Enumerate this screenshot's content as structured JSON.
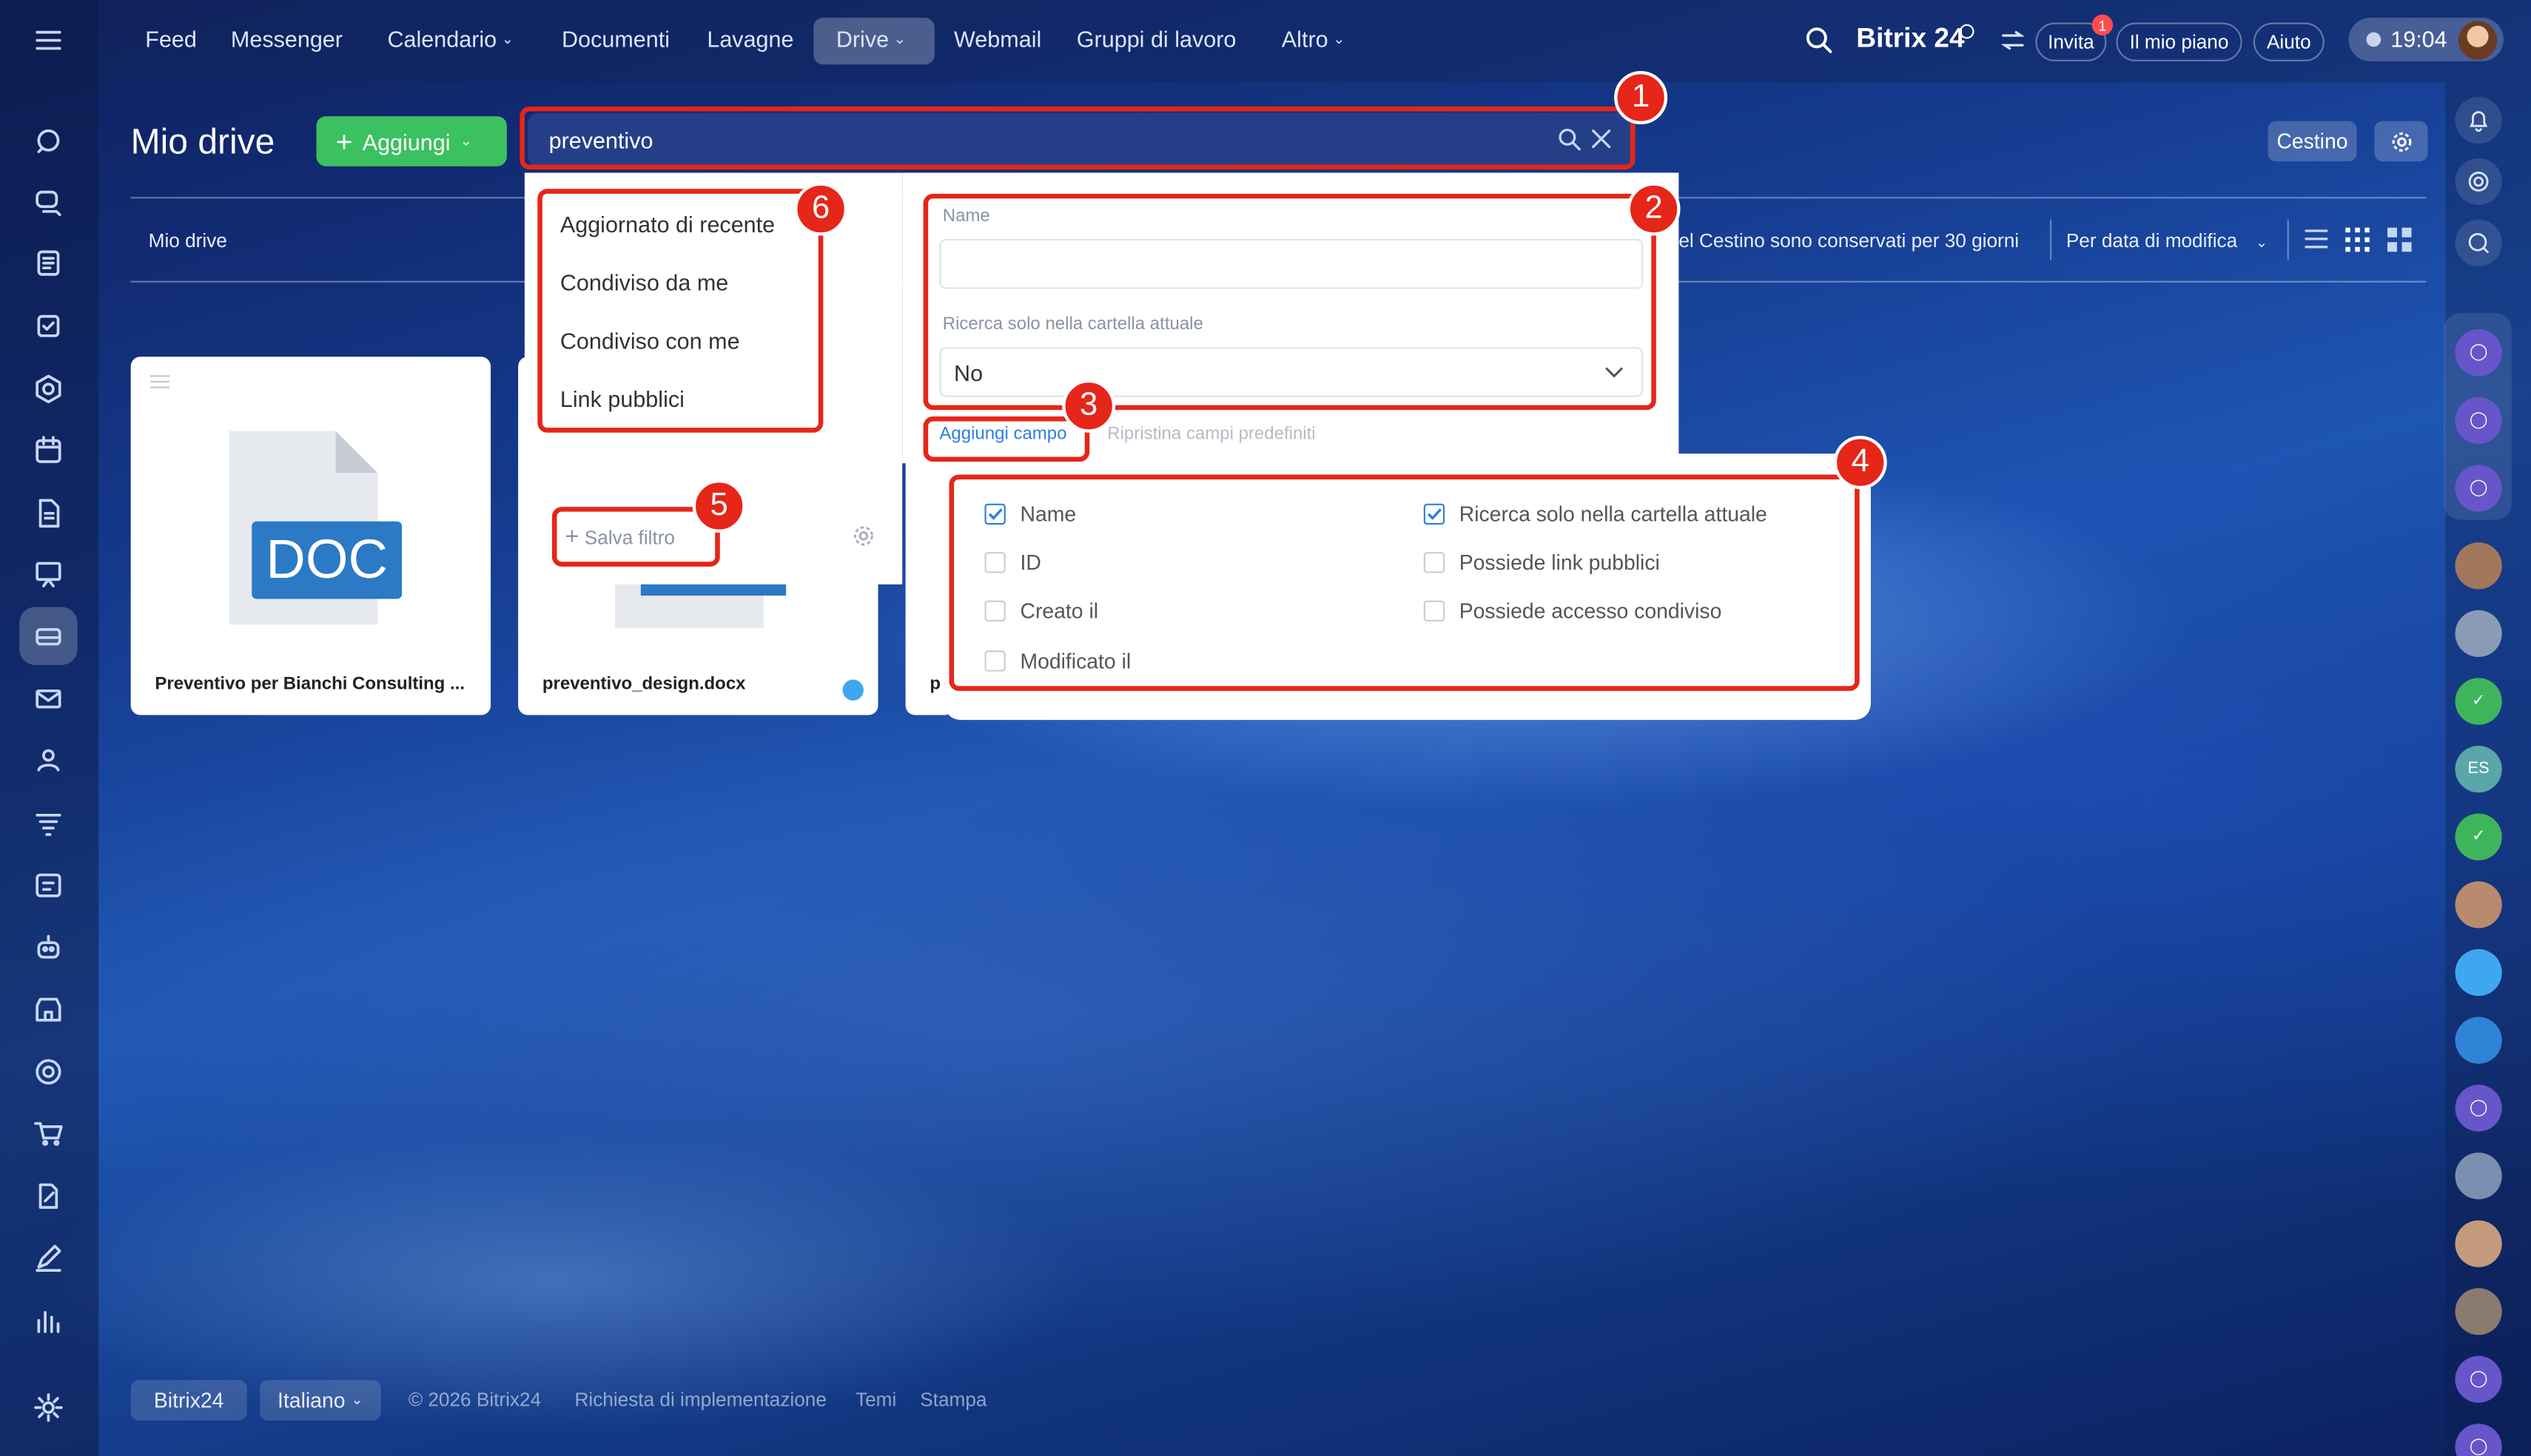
{
  "nav": {
    "items": [
      {
        "label": "Feed"
      },
      {
        "label": "Messenger"
      },
      {
        "label": "Calendario"
      },
      {
        "label": "Documenti"
      },
      {
        "label": "Lavagne"
      },
      {
        "label": "Drive"
      },
      {
        "label": "Webmail"
      },
      {
        "label": "Gruppi di lavoro"
      },
      {
        "label": "Altro"
      }
    ],
    "active": "Drive"
  },
  "header": {
    "brand": "Bitrix 24",
    "invite_label": "Invita",
    "invite_badge": "1",
    "plan_label": "Il mio piano",
    "help_label": "Aiuto",
    "time": "19:04"
  },
  "page": {
    "title": "Mio drive",
    "add_button": "Aggiungi",
    "search_value": "preventivo",
    "trash_button": "Cestino",
    "breadcrumb": "Mio drive",
    "trash_info": "el Cestino sono conservati per 30 giorni",
    "sort_label": "Per data di modifica"
  },
  "files": [
    {
      "name": "Preventivo per Bianchi Consulting ...",
      "type": "DOC"
    },
    {
      "name": "preventivo_design.docx"
    },
    {
      "name": "p"
    }
  ],
  "filter": {
    "presets": [
      "Aggiornato di recente",
      "Condiviso da me",
      "Condiviso con me",
      "Link pubblici"
    ],
    "save_filter": "Salva filtro",
    "name_label": "Name",
    "name_value": "",
    "folder_label": "Ricerca solo nella cartella attuale",
    "folder_value": "No",
    "add_field": "Aggiungi campo",
    "restore_fields": "Ripristina campi predefiniti",
    "fields": [
      {
        "label": "Name",
        "checked": true
      },
      {
        "label": "ID",
        "checked": false
      },
      {
        "label": "Creato il",
        "checked": false
      },
      {
        "label": "Modificato il",
        "checked": false
      },
      {
        "label": "Ricerca solo nella cartella attuale",
        "checked": true
      },
      {
        "label": "Possiede link pubblici",
        "checked": false
      },
      {
        "label": "Possiede accesso condiviso",
        "checked": false
      }
    ]
  },
  "annotations": [
    "1",
    "2",
    "3",
    "4",
    "5",
    "6"
  ],
  "rightbar": {
    "es_label": "ES"
  },
  "footer": {
    "brand": "Bitrix24",
    "language": "Italiano",
    "copyright": "© 2026 Bitrix24",
    "links": [
      "Richiesta di implementazione",
      "Temi",
      "Stampa"
    ]
  },
  "colors": {
    "accent": "#3bc160",
    "annotation": "#e52619",
    "link": "#2f7ee0",
    "doc_badge": "#2c79c5"
  }
}
